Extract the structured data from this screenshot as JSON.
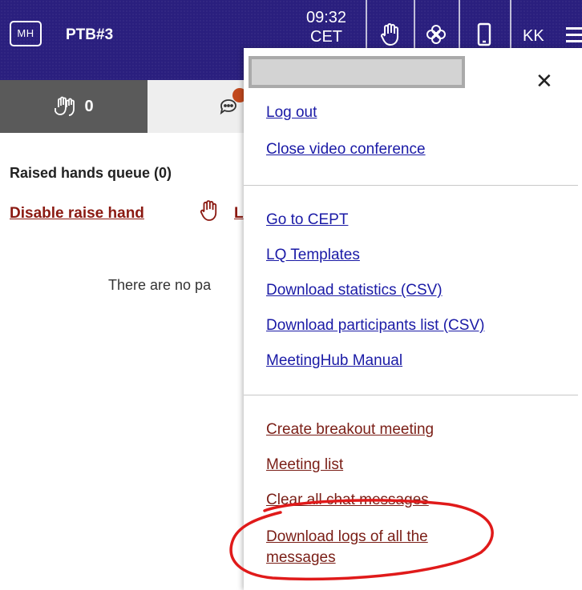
{
  "header": {
    "logo": "MH",
    "room": "PTB#3",
    "time": "09:32",
    "timezone": "CET",
    "initials": "KK"
  },
  "tabs": {
    "raised_count": "0"
  },
  "content": {
    "queue_title": "Raised hands queue (0)",
    "disable_raise_hand": "Disable raise hand",
    "second_link_partial": "L",
    "empty_message": "There are no pa"
  },
  "menu": {
    "group1": [
      "Log out",
      "Close video conference"
    ],
    "group2": [
      "Go to CEPT",
      "LQ Templates",
      "Download statistics (CSV)",
      "Download participants list (CSV)",
      "MeetingHub Manual"
    ],
    "group3": [
      "Create breakout meeting",
      "Meeting list",
      "Clear all chat messages"
    ],
    "download_logs_line1": "Download logs of all the",
    "download_logs_line2": "messages",
    "close_symbol": "✕"
  },
  "colors": {
    "header_bg": "#2a1f7e",
    "link_blue": "#1a1aa6",
    "link_red": "#7a1e16",
    "annotation": "#e01a1a"
  },
  "icons": [
    "hand-icon",
    "flower-icon",
    "phone-icon",
    "menu-icon",
    "raised-hands-icon",
    "chat-icon",
    "close-icon"
  ]
}
